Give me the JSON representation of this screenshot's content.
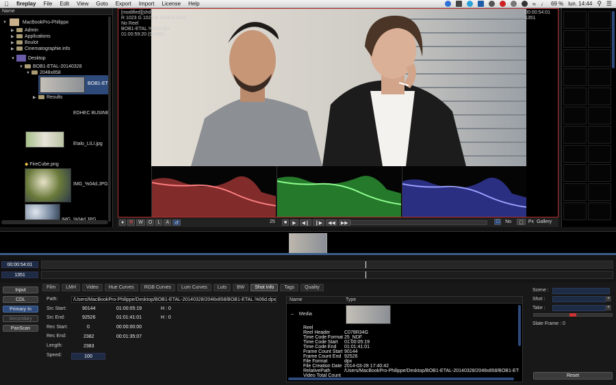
{
  "menubar": {
    "app_name": "fireplay",
    "items": [
      "File",
      "Edit",
      "View",
      "Goto",
      "Export",
      "Import",
      "License",
      "Help"
    ],
    "battery": "69 %",
    "clock": "lun. 14:44"
  },
  "browser": {
    "header": "Name",
    "root": "MacBookPro-Philippe",
    "folders": [
      "Admin",
      "Applications",
      "Boulot",
      "Cinematographie.info"
    ],
    "desktop": "Desktop",
    "project": "BOB1-ETAL-20140328",
    "resolution": "2048x858",
    "clip": "BOB1-ET",
    "results": "Results",
    "files": {
      "edhec": "EDHEC BUSINE",
      "etalo": "Etalo_LILI.jpg",
      "firecube": "FireCube.png",
      "img1": "IMG_%04d.JPG",
      "img2": "IMG_%04d.JPG"
    }
  },
  "viewer": {
    "overlay_top_left": "[modified][shd]\nR 1023 G 1023 B 1023 A 1023\nNo Reel\nBOB1-ETAL.%06d.dpx\n01:00:59:20 (91495)",
    "overlay_top_right": "00:00:54:01\n1351"
  },
  "viewer_toolbar": {
    "modes": [
      "W",
      "O",
      "L",
      "A"
    ],
    "fps": "25",
    "zoom_label": "No",
    "px_label": "Px",
    "gallery_label": "Gallery"
  },
  "timeline": {
    "timecode": "00:00:54:01",
    "frame": "1351"
  },
  "left_buttons": [
    "Input",
    "CDL",
    "Primary In",
    "Secondary",
    "PanScan"
  ],
  "tabs": [
    "Film",
    "LMH",
    "Video",
    "Hue Curves",
    "RGB Curves",
    "Lum Curves",
    "Luts",
    "BW",
    "Shot Info",
    "Tags",
    "Quality"
  ],
  "active_tab": "Shot Info",
  "shot_info": {
    "path_label": "Path:",
    "path_value": "/Users/MacBookPro-Philippe/Desktop/BOB1-ETAL-20140328/2048x858/BOB1-ETAL.%06d.dpx",
    "src_start_label": "Src Start:",
    "src_start_frame": "90144",
    "src_start_tc": "01:00:05:19",
    "src_start_h": "H : 0",
    "src_end_label": "Src End:",
    "src_end_frame": "92526",
    "src_end_tc": "01:01:41:01",
    "src_end_h": "H : 0",
    "rec_start_label": "Rec Start:",
    "rec_start_frame": "0",
    "rec_start_tc": "00:00:00:00",
    "rec_end_label": "Rec End:",
    "rec_end_frame": "2382",
    "rec_end_tc": "00:01:35:07",
    "length_label": "Length:",
    "length_value": "2383",
    "speed_label": "Speed:",
    "speed_value": "100"
  },
  "metadata": {
    "col_name": "Name",
    "col_type": "Type",
    "group": "Media",
    "rows": [
      {
        "k": "Reel",
        "v": ""
      },
      {
        "k": "Reel Header",
        "v": "C078R34G"
      },
      {
        "k": "Time Code Format",
        "v": "25_NDF"
      },
      {
        "k": "Time Code Start",
        "v": "01:00:05:19"
      },
      {
        "k": "Time Code End",
        "v": "01:01:41:01"
      },
      {
        "k": "Frame Count Start",
        "v": "90144"
      },
      {
        "k": "Frame Count End",
        "v": "92526"
      },
      {
        "k": "File Format",
        "v": "dpx"
      },
      {
        "k": "File Creation Date",
        "v": "2014-03-28 17:40:42"
      },
      {
        "k": "RelativePath",
        "v": "/Users/MacBookPro-Philippe/Desktop/BOB1-ETAL-20140328/2048x858/BOB1-ET"
      },
      {
        "k": "Video Total Count",
        "v": ""
      }
    ]
  },
  "scene_panel": {
    "scene_label": "Scene :",
    "shot_label": "Shot :",
    "take_label": "Take :",
    "slate_label": "Slate Frame : 0",
    "reset_label": "Reset",
    "plus": "+"
  },
  "colors": {
    "accent": "#2d4a7a",
    "viewer_border": "#bb3333"
  }
}
